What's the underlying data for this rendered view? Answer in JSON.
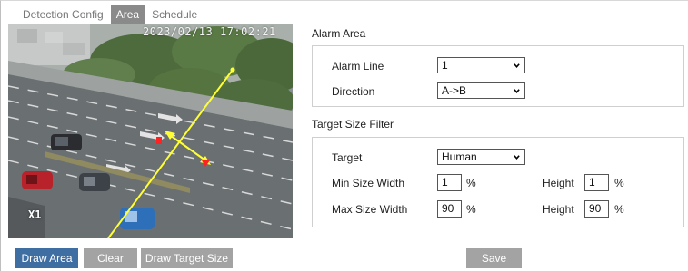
{
  "tabs": [
    {
      "label": "Detection Config",
      "active": false
    },
    {
      "label": "Area",
      "active": true
    },
    {
      "label": "Schedule",
      "active": false
    }
  ],
  "preview": {
    "timestamp": "2023/02/13 17:02:21",
    "zoom": "X1"
  },
  "buttons": {
    "draw_area": "Draw Area",
    "clear": "Clear",
    "draw_target_size": "Draw Target Size",
    "save": "Save"
  },
  "alarm_area": {
    "title": "Alarm Area",
    "alarm_line_label": "Alarm Line",
    "alarm_line_value": "1",
    "direction_label": "Direction",
    "direction_value": "A->B"
  },
  "target_filter": {
    "title": "Target Size Filter",
    "target_label": "Target",
    "target_value": "Human",
    "min_size_width_label": "Min Size Width",
    "min_size_width_value": "1",
    "min_height_label": "Height",
    "min_height_value": "1",
    "max_size_width_label": "Max Size Width",
    "max_size_width_value": "90",
    "max_height_label": "Height",
    "max_height_value": "90",
    "unit": "%"
  },
  "colors": {
    "primary_button": "#3f6ea3",
    "secondary_button": "#a3a3a3",
    "active_tab": "#8a8a8a",
    "line_overlay": "#ffff33",
    "arrow_marker": "#ff2222"
  }
}
